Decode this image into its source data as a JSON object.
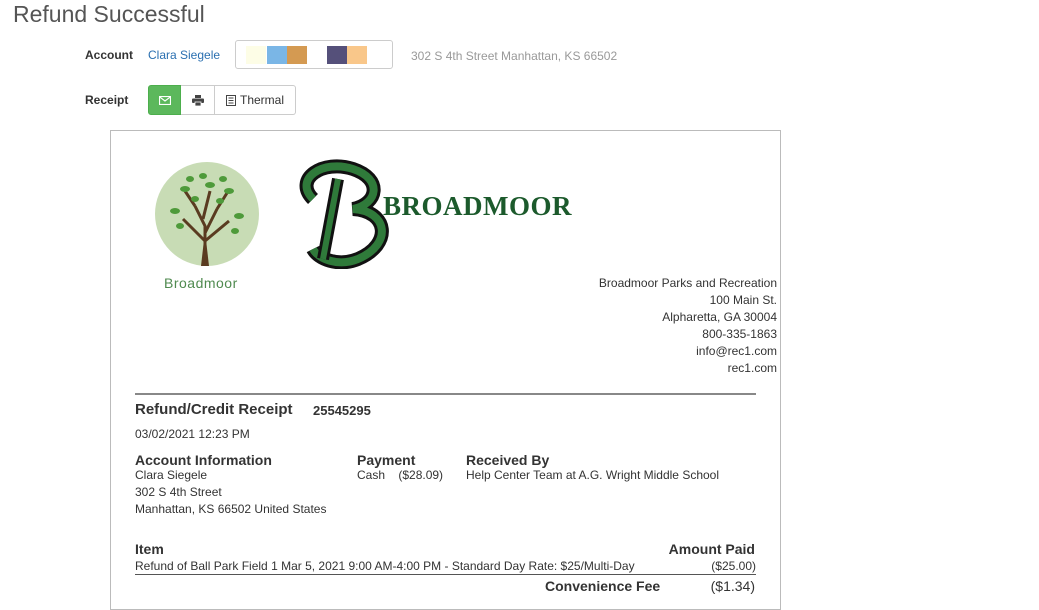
{
  "page": {
    "title": "Refund Successful"
  },
  "account": {
    "label": "Account",
    "name": "Clara Siegele",
    "address": "302 S 4th Street Manhattan, KS 66502",
    "swatches": [
      "#fdfde6",
      "#7ab6e6",
      "#d49a52",
      "#55507a",
      "#f9c78a"
    ]
  },
  "receipt_bar": {
    "label": "Receipt",
    "email_icon": "envelope-icon",
    "print_icon": "printer-icon",
    "thermal_icon": "document-icon",
    "thermal_label": "Thermal"
  },
  "receipt": {
    "logo_caption": "Broadmoor",
    "brand_word": "BROADMOOR",
    "org": {
      "name": "Broadmoor Parks and Recreation",
      "street": "100 Main St.",
      "city": "Alpharetta, GA 30004",
      "phone": "800-335-1863",
      "email": "info@rec1.com",
      "web": "rec1.com"
    },
    "title": "Refund/Credit Receipt",
    "number": "25545295",
    "date": "03/02/2021 12:23 PM",
    "account_info": {
      "heading": "Account Information",
      "name": "Clara Siegele",
      "street": "302 S 4th Street",
      "city": "Manhattan, KS 66502 United States"
    },
    "payment": {
      "heading": "Payment",
      "method": "Cash",
      "amount": "($28.09)"
    },
    "received_by": {
      "heading": "Received By",
      "value": "Help Center Team at A.G. Wright Middle School"
    },
    "items_header": {
      "item": "Item",
      "amount": "Amount Paid"
    },
    "items": [
      {
        "description": "Refund of Ball Park Field 1 Mar 5, 2021 9:00 AM-4:00 PM - Standard Day Rate: $25/Multi-Day",
        "amount": "($25.00)"
      }
    ],
    "convenience_fee": {
      "label": "Convenience Fee",
      "amount": "($1.34)"
    }
  }
}
